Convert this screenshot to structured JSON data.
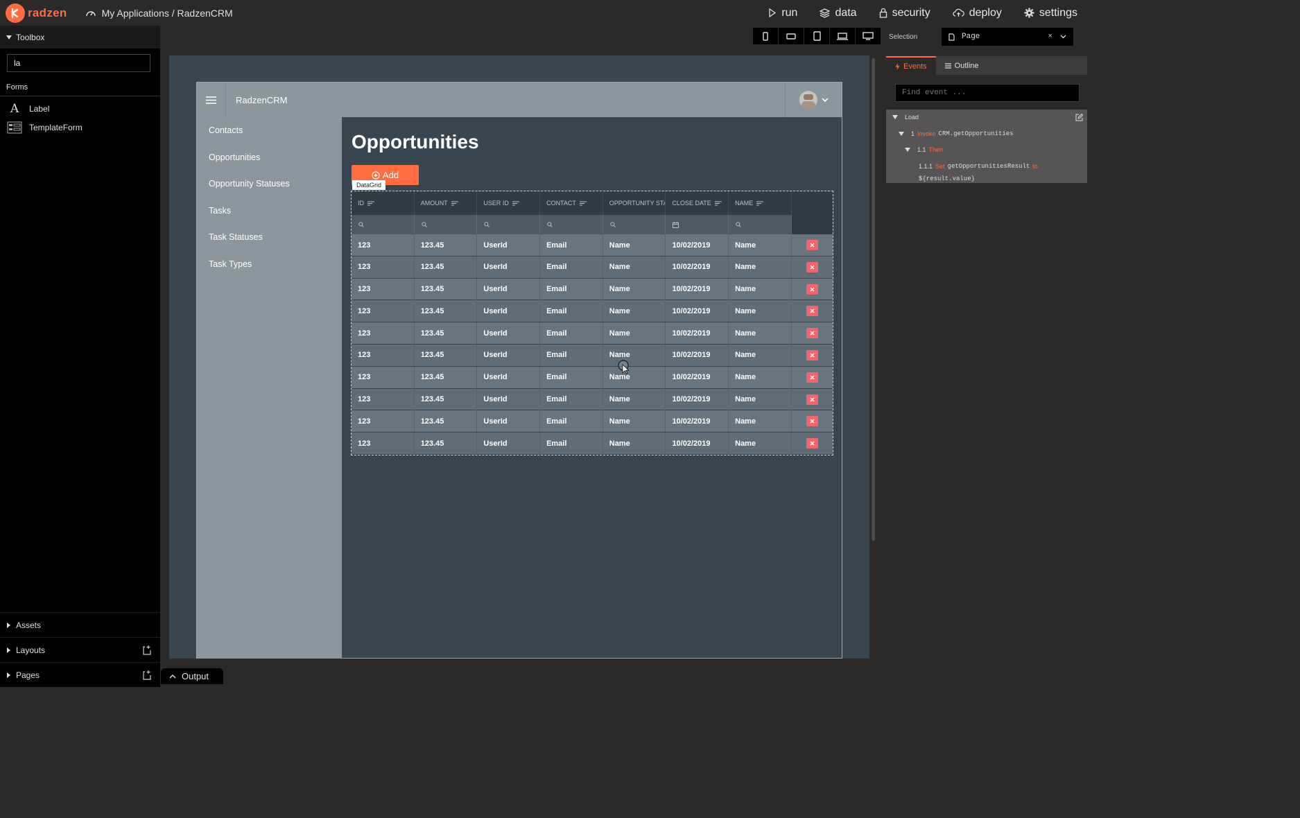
{
  "topbar": {
    "logo_text": "radzen",
    "breadcrumb": "My Applications / RadzenCRM",
    "nav": [
      {
        "label": "run",
        "icon": "play-icon"
      },
      {
        "label": "data",
        "icon": "layers-icon"
      },
      {
        "label": "security",
        "icon": "lock-icon"
      },
      {
        "label": "deploy",
        "icon": "cloud-upload-icon"
      },
      {
        "label": "settings",
        "icon": "gear-icon"
      }
    ]
  },
  "toolbox": {
    "title": "Toolbox",
    "search_value": "la",
    "section": "Forms",
    "items": [
      {
        "label": "Label",
        "icon": "label-icon"
      },
      {
        "label": "TemplateForm",
        "icon": "template-form-icon"
      }
    ],
    "bottom": [
      {
        "label": "Assets"
      },
      {
        "label": "Layouts"
      },
      {
        "label": "Pages"
      }
    ]
  },
  "devices": [
    "phone-portrait",
    "phone-landscape",
    "tablet-portrait",
    "laptop",
    "desktop"
  ],
  "app": {
    "title": "RadzenCRM",
    "menu": [
      "Contacts",
      "Opportunities",
      "Opportunity Statuses",
      "Tasks",
      "Task Statuses",
      "Task Types"
    ],
    "page_title": "Opportunities",
    "add_label": "Add",
    "datagrid_tag": "DataGrid",
    "grid": {
      "columns": [
        "ID",
        "AMOUNT",
        "USER ID",
        "CONTACT",
        "OPPORTUNITY STAT",
        "CLOSE DATE",
        "NAME"
      ],
      "rows": [
        [
          "123",
          "123.45",
          "UserId",
          "Email",
          "Name",
          "10/02/2019",
          "Name"
        ],
        [
          "123",
          "123.45",
          "UserId",
          "Email",
          "Name",
          "10/02/2019",
          "Name"
        ],
        [
          "123",
          "123.45",
          "UserId",
          "Email",
          "Name",
          "10/02/2019",
          "Name"
        ],
        [
          "123",
          "123.45",
          "UserId",
          "Email",
          "Name",
          "10/02/2019",
          "Name"
        ],
        [
          "123",
          "123.45",
          "UserId",
          "Email",
          "Name",
          "10/02/2019",
          "Name"
        ],
        [
          "123",
          "123.45",
          "UserId",
          "Email",
          "Name",
          "10/02/2019",
          "Name"
        ],
        [
          "123",
          "123.45",
          "UserId",
          "Email",
          "Name",
          "10/02/2019",
          "Name"
        ],
        [
          "123",
          "123.45",
          "UserId",
          "Email",
          "Name",
          "10/02/2019",
          "Name"
        ],
        [
          "123",
          "123.45",
          "UserId",
          "Email",
          "Name",
          "10/02/2019",
          "Name"
        ],
        [
          "123",
          "123.45",
          "UserId",
          "Email",
          "Name",
          "10/02/2019",
          "Name"
        ]
      ]
    }
  },
  "output_label": "Output",
  "right_panel": {
    "selection_label": "Selection",
    "selection_value": "Page",
    "tabs": [
      "Events",
      "Outline"
    ],
    "find_placeholder": "Find event ...",
    "events": {
      "load": "Load",
      "invoke_num": "1",
      "invoke_kw": "Invoke",
      "invoke_target": "CRM.getOpportunities",
      "then_num": "1.1",
      "then_kw": "Then",
      "set_num": "1.1.1",
      "set_kw": "Set",
      "set_target": "getOpportunitiesResult",
      "set_to": "to",
      "set_value": "${result.value}"
    }
  },
  "colors": {
    "accent": "#ff6d41",
    "delete": "#f0666b",
    "canvas": "#384652",
    "sidebar": "#8a979f"
  }
}
